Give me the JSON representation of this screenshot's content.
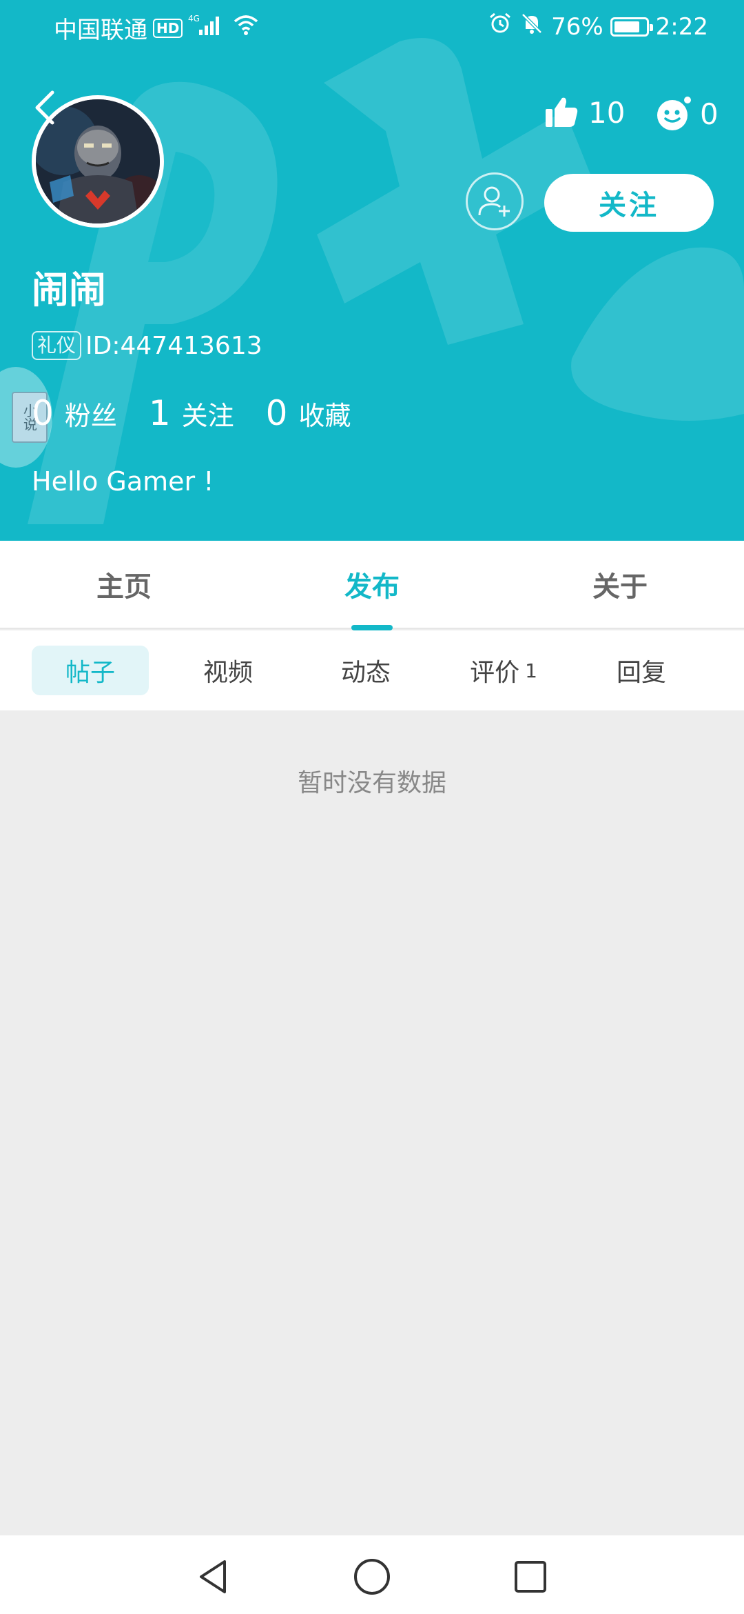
{
  "status_bar": {
    "carrier": "中国联通",
    "hd": "HD",
    "network": "4G",
    "battery": "76%",
    "time": "2:22"
  },
  "profile": {
    "username": "闹闹",
    "tag": "礼仪",
    "id_text": "ID:447413613",
    "likes": "10",
    "reactions": "0",
    "follow_label": "关注",
    "bio": "Hello Gamer !",
    "stats": [
      {
        "num": "0",
        "label": "粉丝"
      },
      {
        "num": "1",
        "label": "关注"
      },
      {
        "num": "0",
        "label": "收藏"
      }
    ],
    "float_badge_text": "小说"
  },
  "main_tabs": [
    {
      "label": "主页",
      "active": false
    },
    {
      "label": "发布",
      "active": true
    },
    {
      "label": "关于",
      "active": false
    }
  ],
  "sub_tabs": [
    {
      "label": "帖子",
      "count": "",
      "active": true
    },
    {
      "label": "视频",
      "count": "",
      "active": false
    },
    {
      "label": "动态",
      "count": "",
      "active": false
    },
    {
      "label": "评价",
      "count": "1",
      "active": false
    },
    {
      "label": "回复",
      "count": "",
      "active": false
    }
  ],
  "empty_state": "暂时没有数据",
  "colors": {
    "accent": "#13b8c8",
    "background": "#ededed"
  }
}
